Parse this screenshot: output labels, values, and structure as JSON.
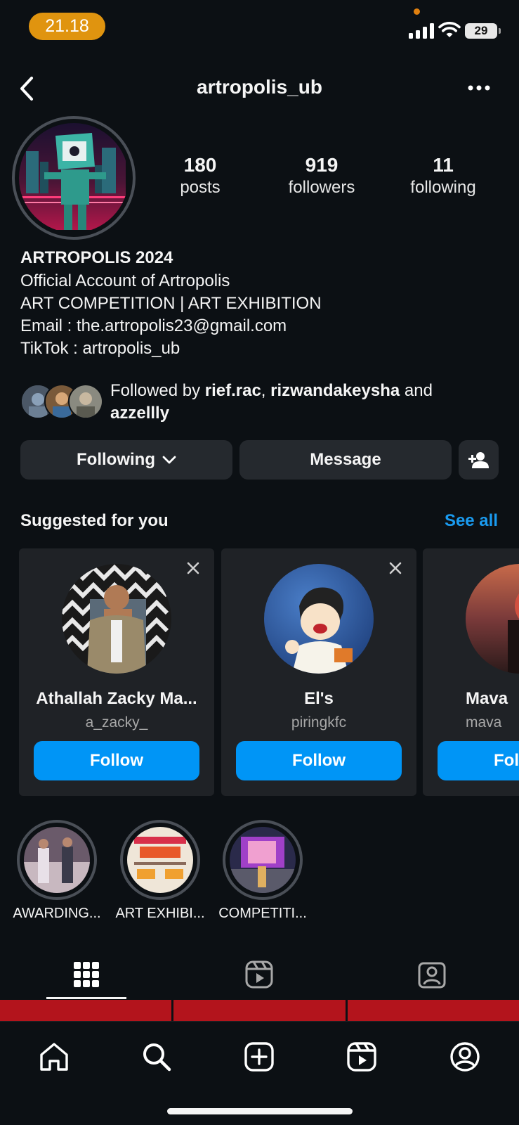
{
  "status": {
    "time": "21.18",
    "battery": "29"
  },
  "header": {
    "username": "artropolis_ub"
  },
  "stats": {
    "posts": {
      "value": "180",
      "label": "posts"
    },
    "followers": {
      "value": "919",
      "label": "followers"
    },
    "following": {
      "value": "11",
      "label": "following"
    }
  },
  "bio": {
    "name": "ARTROPOLIS 2024",
    "lines": [
      "Official Account of Artropolis",
      "ART COMPETITION | ART EXHIBITION",
      "Email : the.artropolis23@gmail.com",
      "TikTok : artropolis_ub"
    ]
  },
  "followed_by": {
    "prefix": "Followed by ",
    "user1": "rief.rac",
    "sep": ", ",
    "user2": "rizwandakeysha",
    "and": " and",
    "user3": "azzellly"
  },
  "actions": {
    "following": "Following",
    "message": "Message"
  },
  "suggested": {
    "title": "Suggested for you",
    "see_all": "See all",
    "cards": [
      {
        "name": "Athallah Zacky Ma...",
        "username": "a_zacky_",
        "button": "Follow"
      },
      {
        "name": "El's",
        "username": "piringkfc",
        "button": "Follow"
      },
      {
        "name": "Mava",
        "username": "mava",
        "button": "Fol"
      }
    ]
  },
  "highlights": [
    {
      "label": "AWARDING..."
    },
    {
      "label": "ART EXHIBI..."
    },
    {
      "label": "COMPETITI..."
    }
  ],
  "icons": {
    "back": "chevron-left-icon",
    "more": "more-horizontal-icon",
    "add_person": "person-add-icon",
    "close": "close-icon",
    "grid": "grid-icon",
    "reels": "reels-icon",
    "tagged": "tagged-icon",
    "home": "home-icon",
    "search": "search-icon",
    "create": "create-icon",
    "profile": "profile-icon"
  },
  "colors": {
    "background": "#0c1014",
    "accent": "#0095f6",
    "link": "#1a9bf0",
    "button_gray": "#25292e",
    "time_pill": "#e0940f"
  }
}
